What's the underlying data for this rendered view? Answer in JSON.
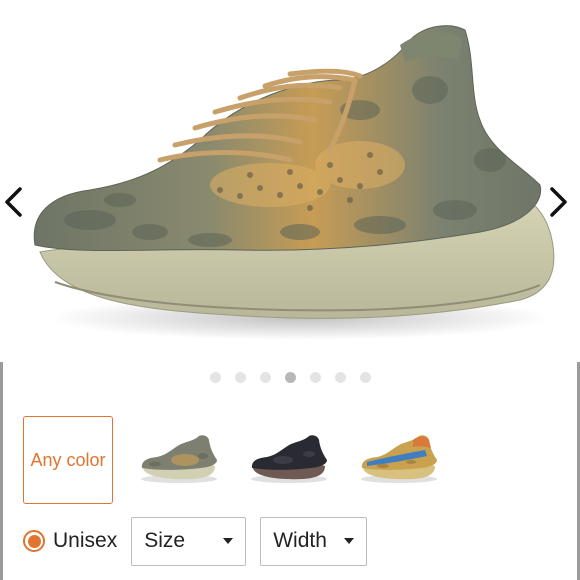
{
  "gallery": {
    "image_icon": "sneaker-image",
    "prev_icon": "chevron-left-icon",
    "next_icon": "chevron-right-icon",
    "dot_count": 7,
    "active_dot": 4
  },
  "color_options": {
    "any_color_label": "Any color",
    "swatches": [
      "sneaker-thumbnail-grey",
      "sneaker-thumbnail-black",
      "sneaker-thumbnail-multicolor"
    ]
  },
  "filters": {
    "unisex_label": "Unisex",
    "size_label": "Size",
    "width_label": "Width"
  },
  "colors": {
    "accent": "#e1742f",
    "dot_inactive": "#e4e4e4",
    "dot_active": "#b7b7b7"
  }
}
